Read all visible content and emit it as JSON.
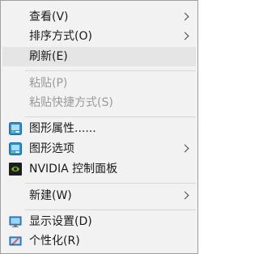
{
  "menu": {
    "items": [
      {
        "label": "查看(V)",
        "has_submenu": true,
        "disabled": false
      },
      {
        "label": "排序方式(O)",
        "has_submenu": true,
        "disabled": false
      },
      {
        "label": "刷新(E)",
        "has_submenu": false,
        "disabled": false,
        "highlighted": true
      },
      {
        "label": "粘贴(P)",
        "has_submenu": false,
        "disabled": true
      },
      {
        "label": "粘贴快捷方式(S)",
        "has_submenu": false,
        "disabled": true
      },
      {
        "label": "图形属性......",
        "has_submenu": false,
        "disabled": false,
        "icon": "intel-graphics-icon"
      },
      {
        "label": "图形选项",
        "has_submenu": true,
        "disabled": false,
        "icon": "intel-graphics-icon"
      },
      {
        "label": "NVIDIA 控制面板",
        "has_submenu": false,
        "disabled": false,
        "icon": "nvidia-icon"
      },
      {
        "label": "新建(W)",
        "has_submenu": true,
        "disabled": false
      },
      {
        "label": "显示设置(D)",
        "has_submenu": false,
        "disabled": false,
        "icon": "display-settings-icon"
      },
      {
        "label": "个性化(R)",
        "has_submenu": false,
        "disabled": false,
        "icon": "personalize-icon"
      }
    ]
  },
  "colors": {
    "menu_background": "#f2f2f2",
    "border": "#a0a0a0",
    "highlight": "#e5e5e5",
    "disabled_text": "#9a9a9a",
    "nvidia_green": "#76b900"
  }
}
